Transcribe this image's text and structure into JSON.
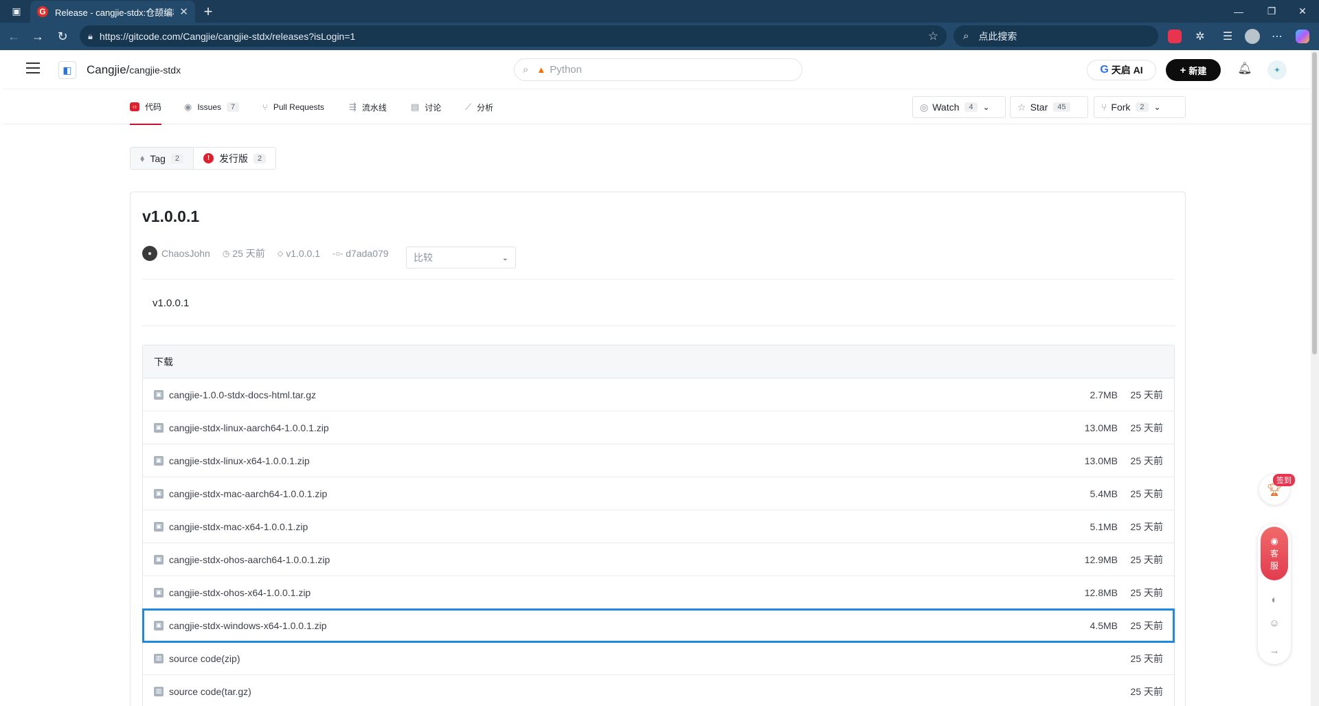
{
  "browser": {
    "tab_title": "Release - cangjie-stdx:仓颉编程语言",
    "url": "https://gitcode.com/Cangjie/cangjie-stdx/releases?isLogin=1",
    "search_placeholder": "点此搜索",
    "icons": [
      "tab-actions-icon",
      "back-icon",
      "forward-icon",
      "refresh-icon",
      "lock-icon",
      "favorite-star-icon",
      "search-icon",
      "extension-icon",
      "puzzle-icon",
      "favorites-icon",
      "profile-icon",
      "more-icon",
      "copilot-icon"
    ]
  },
  "header": {
    "owner": "Cangjie/",
    "repo": "cangjie-stdx",
    "search_placeholder": "Python",
    "ai_button": "天启 AI",
    "new_button": "新建"
  },
  "repo_nav": {
    "items": [
      {
        "label": "代码",
        "active": true
      },
      {
        "label": "Issues",
        "count": "7"
      },
      {
        "label": "Pull Requests"
      },
      {
        "label": "流水线"
      },
      {
        "label": "讨论"
      },
      {
        "label": "分析"
      }
    ],
    "watch": {
      "label": "Watch",
      "count": "4"
    },
    "star": {
      "label": "Star",
      "count": "45"
    },
    "fork": {
      "label": "Fork",
      "count": "2"
    }
  },
  "segment": {
    "tag": {
      "label": "Tag",
      "count": "2"
    },
    "release": {
      "label": "发行版",
      "count": "2"
    }
  },
  "release": {
    "title": "v1.0.0.1",
    "author": "ChaosJohn",
    "time": "25 天前",
    "tag": "v1.0.0.1",
    "commit": "d7ada079",
    "compare_placeholder": "比较",
    "body": "v1.0.0.1",
    "downloads_header": "下载",
    "files": [
      {
        "name": "cangjie-1.0.0-stdx-docs-html.tar.gz",
        "size": "2.7MB",
        "date": "25 天前"
      },
      {
        "name": "cangjie-stdx-linux-aarch64-1.0.0.1.zip",
        "size": "13.0MB",
        "date": "25 天前"
      },
      {
        "name": "cangjie-stdx-linux-x64-1.0.0.1.zip",
        "size": "13.0MB",
        "date": "25 天前"
      },
      {
        "name": "cangjie-stdx-mac-aarch64-1.0.0.1.zip",
        "size": "5.4MB",
        "date": "25 天前"
      },
      {
        "name": "cangjie-stdx-mac-x64-1.0.0.1.zip",
        "size": "5.1MB",
        "date": "25 天前"
      },
      {
        "name": "cangjie-stdx-ohos-aarch64-1.0.0.1.zip",
        "size": "12.9MB",
        "date": "25 天前"
      },
      {
        "name": "cangjie-stdx-ohos-x64-1.0.0.1.zip",
        "size": "12.8MB",
        "date": "25 天前"
      },
      {
        "name": "cangjie-stdx-windows-x64-1.0.0.1.zip",
        "size": "4.5MB",
        "date": "25 天前"
      },
      {
        "name": "source code(zip)",
        "size": "",
        "date": "25 天前"
      },
      {
        "name": "source code(tar.gz)",
        "size": "",
        "date": "25 天前"
      }
    ]
  },
  "floating": {
    "checkin_badge": "签到",
    "service_label_1": "客",
    "service_label_2": "服"
  },
  "colors": {
    "browser_chrome": "#234a6b",
    "accent_red": "#e01f2d",
    "selection_blue": "#1e88e5"
  }
}
